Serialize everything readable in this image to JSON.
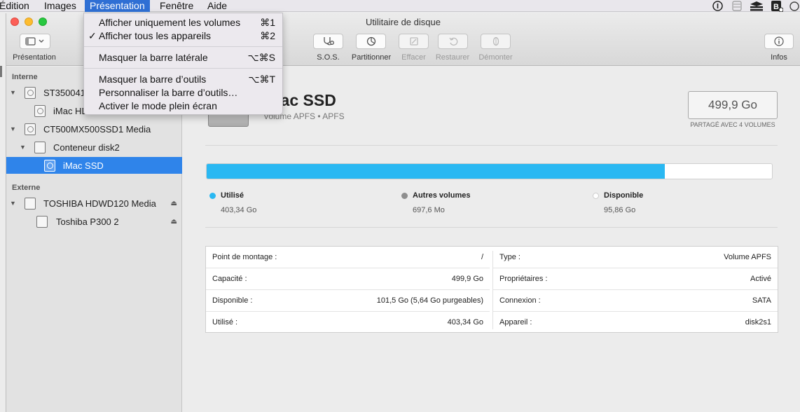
{
  "menubar": {
    "items": [
      "Édition",
      "Images",
      "Présentation",
      "Fenêtre",
      "Aide"
    ],
    "active_index": 2,
    "status_icons": [
      "info-circle-icon",
      "database-icon",
      "stack-icon",
      "bonjour-icon",
      "beta-icon"
    ]
  },
  "window": {
    "title": "Utilitaire de disque",
    "toolbar": {
      "presentation": "Présentation",
      "sos": "S.O.S.",
      "partition": "Partitionner",
      "erase": "Effacer",
      "restore": "Restaurer",
      "unmount": "Démonter",
      "info": "Infos"
    }
  },
  "sidebar": {
    "sections": [
      {
        "label": "Interne"
      },
      {
        "label": "Externe"
      }
    ],
    "items": [
      {
        "label": "ST3500418AS Media"
      },
      {
        "label": "iMac HD"
      },
      {
        "label": "CT500MX500SSD1 Media"
      },
      {
        "label": "Conteneur disk2"
      },
      {
        "label": "iMac SSD"
      },
      {
        "label": "TOSHIBA HDWD120 Media"
      },
      {
        "label": "Toshiba P300 2"
      }
    ],
    "selected_index": 4
  },
  "volume": {
    "name": "iMac SSD",
    "subtitle": "Volume APFS • APFS",
    "capacity": "499,9 Go",
    "shared_note": "PARTAGÉ AVEC 4 VOLUMES",
    "usage_fraction": 0.81,
    "legend": [
      {
        "label": "Utilisé",
        "value": "403,34 Go",
        "color": "#2ab8f2"
      },
      {
        "label": "Autres volumes",
        "value": "697,6 Mo",
        "color": "#8e8e8e"
      },
      {
        "label": "Disponible",
        "value": "95,86 Go",
        "color": "#ffffff"
      }
    ]
  },
  "info_table": {
    "left": [
      {
        "key": "Point de montage :",
        "value": "/"
      },
      {
        "key": "Capacité :",
        "value": "499,9 Go"
      },
      {
        "key": "Disponible :",
        "value": "101,5 Go (5,64 Go purgeables)"
      },
      {
        "key": "Utilisé :",
        "value": "403,34 Go"
      }
    ],
    "right": [
      {
        "key": "Type :",
        "value": "Volume APFS"
      },
      {
        "key": "Propriétaires :",
        "value": "Activé"
      },
      {
        "key": "Connexion :",
        "value": "SATA"
      },
      {
        "key": "Appareil :",
        "value": "disk2s1"
      }
    ]
  },
  "view_menu": {
    "items": [
      {
        "label": "Afficher uniquement les volumes",
        "shortcut": "⌘1",
        "checked": false
      },
      {
        "label": "Afficher tous les appareils",
        "shortcut": "⌘2",
        "checked": true
      },
      {
        "label": "Masquer la barre latérale",
        "shortcut": "⌥⌘S",
        "checked": false
      },
      {
        "label": "Masquer la barre d’outils",
        "shortcut": "⌥⌘T",
        "checked": false
      },
      {
        "label": "Personnaliser la barre d’outils…",
        "shortcut": "",
        "checked": false
      },
      {
        "label": "Activer le mode plein écran",
        "shortcut": "",
        "checked": false
      }
    ],
    "check_mark": "✓"
  }
}
